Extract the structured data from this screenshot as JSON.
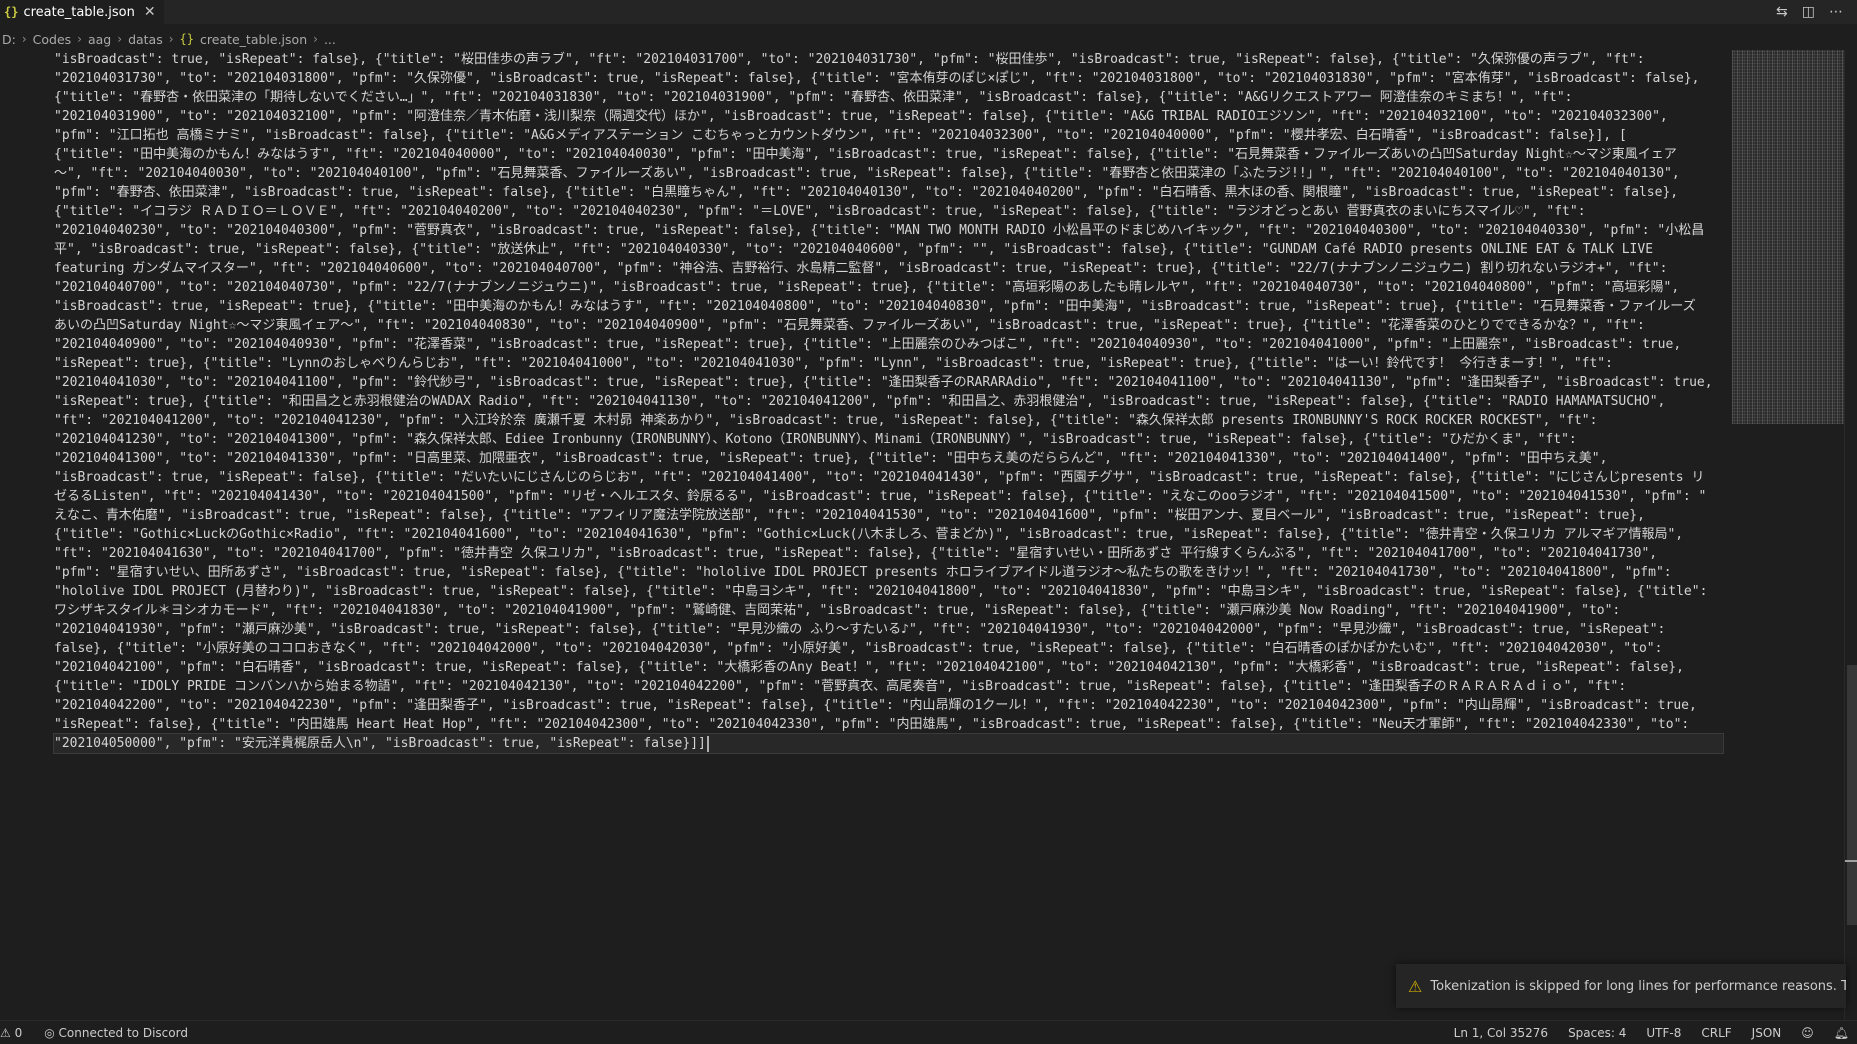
{
  "tab": {
    "label": "create_table.json",
    "icon": "{}"
  },
  "breadcrumb": {
    "items": [
      "D:",
      "Codes",
      "aag",
      "datas"
    ],
    "file_icon": "{}",
    "file": "create_table.json",
    "tail": "..."
  },
  "code_lines": [
    "\"isBroadcast\": true, \"isRepeat\": false}, {\"title\": \"桜田佳歩の声ラブ\", \"ft\": \"202104031700\", \"to\": \"202104031730\", \"pfm\": \"桜田佳歩\", \"isBroadcast\": true, \"isRepeat\": false}, {\"title\": \"久保弥優の声ラブ\", \"ft\":",
    "\"202104031730\", \"to\": \"202104031800\", \"pfm\": \"久保弥優\", \"isBroadcast\": true, \"isRepeat\": false}, {\"title\": \"宮本侑芽のぽじ×ぽじ\", \"ft\": \"202104031800\", \"to\": \"202104031830\", \"pfm\": \"宮本侑芽\", \"isBroadcast\": false},",
    "{\"title\": \"春野杏・依田菜津の「期待しないでください…」\", \"ft\": \"202104031830\", \"to\": \"202104031900\", \"pfm\": \"春野杏、依田菜津\", \"isBroadcast\": false}, {\"title\": \"A&Gリクエストアワー 阿澄佳奈のキミまち！\", \"ft\":",
    "\"202104031900\", \"to\": \"202104032100\", \"pfm\": \"阿澄佳奈／青木佑磨・浅川梨奈（隔週交代）ほか\", \"isBroadcast\": true, \"isRepeat\": false}, {\"title\": \"A&G TRIBAL RADIOエジソン\", \"ft\": \"202104032100\", \"to\": \"202104032300\",",
    "\"pfm\": \"江口拓也 高橋ミナミ\", \"isBroadcast\": false}, {\"title\": \"A&Gメディアステーション こむちゃっとカウントダウン\", \"ft\": \"202104032300\", \"to\": \"202104040000\", \"pfm\": \"櫻井孝宏、白石晴香\", \"isBroadcast\": false}], [",
    "{\"title\": \"田中美海のかもん！みなはうす\", \"ft\": \"202104040000\", \"to\": \"202104040030\", \"pfm\": \"田中美海\", \"isBroadcast\": true, \"isRepeat\": false}, {\"title\": \"石見舞菜香・ファイルーズあいの凸凹Saturday Night☆～マジ東風イェア",
    "～\", \"ft\": \"202104040030\", \"to\": \"202104040100\", \"pfm\": \"石見舞菜香、ファイルーズあい\", \"isBroadcast\": true, \"isRepeat\": false}, {\"title\": \"春野杏と依田菜津の「ふたラジ!!」\", \"ft\": \"202104040100\", \"to\": \"202104040130\",",
    "\"pfm\": \"春野杏、依田菜津\", \"isBroadcast\": true, \"isRepeat\": false}, {\"title\": \"白黒瞳ちゃん\", \"ft\": \"202104040130\", \"to\": \"202104040200\", \"pfm\": \"白石晴香、黒木ほの香、関根瞳\", \"isBroadcast\": true, \"isRepeat\": false},",
    "{\"title\": \"イコラジ ＲＡＤＩＯ＝ＬＯＶＥ\", \"ft\": \"202104040200\", \"to\": \"202104040230\", \"pfm\": \"＝LOVE\", \"isBroadcast\": true, \"isRepeat\": false}, {\"title\": \"ラジオどっとあい 菅野真衣のまいにちスマイル♡\", \"ft\":",
    "\"202104040230\", \"to\": \"202104040300\", \"pfm\": \"菅野真衣\", \"isBroadcast\": true, \"isRepeat\": false}, {\"title\": \"MAN TWO MONTH RADIO 小松昌平のドまじめハイキック\", \"ft\": \"202104040300\", \"to\": \"202104040330\", \"pfm\": \"小松昌",
    "平\", \"isBroadcast\": true, \"isRepeat\": false}, {\"title\": \"放送休止\", \"ft\": \"202104040330\", \"to\": \"202104040600\", \"pfm\": \"\", \"isBroadcast\": false}, {\"title\": \"GUNDAM Café RADIO presents ONLINE EAT & TALK LIVE",
    "featuring ガンダムマイスター\", \"ft\": \"202104040600\", \"to\": \"202104040700\", \"pfm\": \"神谷浩、吉野裕行、水島精二監督\", \"isBroadcast\": true, \"isRepeat\": true}, {\"title\": \"22/7(ナナブンノニジュウニ) 割り切れないラジオ+\", \"ft\":",
    "\"202104040700\", \"to\": \"202104040730\", \"pfm\": \"22/7(ナナブンノニジュウニ)\", \"isBroadcast\": true, \"isRepeat\": true}, {\"title\": \"高垣彩陽のあしたも晴レルヤ\", \"ft\": \"202104040730\", \"to\": \"202104040800\", \"pfm\": \"高垣彩陽\",",
    "\"isBroadcast\": true, \"isRepeat\": true}, {\"title\": \"田中美海のかもん！みなはうす\", \"ft\": \"202104040800\", \"to\": \"202104040830\", \"pfm\": \"田中美海\", \"isBroadcast\": true, \"isRepeat\": true}, {\"title\": \"石見舞菜香・ファイルーズ",
    "あいの凸凹Saturday Night☆～マジ東風イェア～\", \"ft\": \"202104040830\", \"to\": \"202104040900\", \"pfm\": \"石見舞菜香、ファイルーズあい\", \"isBroadcast\": true, \"isRepeat\": true}, {\"title\": \"花澤香菜のひとりでできるかな？\", \"ft\":",
    "\"202104040900\", \"to\": \"202104040930\", \"pfm\": \"花澤香菜\", \"isBroadcast\": true, \"isRepeat\": true}, {\"title\": \"上田麗奈のひみつばこ\", \"ft\": \"202104040930\", \"to\": \"202104041000\", \"pfm\": \"上田麗奈\", \"isBroadcast\": true,",
    "\"isRepeat\": true}, {\"title\": \"Lynnのおしゃべりんらじお\", \"ft\": \"202104041000\", \"to\": \"202104041030\", \"pfm\": \"Lynn\", \"isBroadcast\": true, \"isRepeat\": true}, {\"title\": \"はーい！鈴代です！ 今行きまーす！\", \"ft\":",
    "\"202104041030\", \"to\": \"202104041100\", \"pfm\": \"鈴代紗弓\", \"isBroadcast\": true, \"isRepeat\": true}, {\"title\": \"逢田梨香子のRARARAdio\", \"ft\": \"202104041100\", \"to\": \"202104041130\", \"pfm\": \"逢田梨香子\", \"isBroadcast\": true,",
    "\"isRepeat\": true}, {\"title\": \"和田昌之と赤羽根健治のWADAX Radio\", \"ft\": \"202104041130\", \"to\": \"202104041200\", \"pfm\": \"和田昌之、赤羽根健治\", \"isBroadcast\": true, \"isRepeat\": false}, {\"title\": \"RADIO HAMAMATSUCHO\",",
    "\"ft\": \"202104041200\", \"to\": \"202104041230\", \"pfm\": \"入江玲於奈 廣瀬千夏 木村昴 神楽あかり\", \"isBroadcast\": true, \"isRepeat\": false}, {\"title\": \"森久保祥太郎 presents IRONBUNNY'S ROCK ROCKER ROCKEST\", \"ft\":",
    "\"202104041230\", \"to\": \"202104041300\", \"pfm\": \"森久保祥太郎、Ediee Ironbunny（IRONBUNNY）、Kotono（IRONBUNNY）、Minami（IRONBUNNY）\", \"isBroadcast\": true, \"isRepeat\": false}, {\"title\": \"ひだかくま\", \"ft\":",
    "\"202104041300\", \"to\": \"202104041330\", \"pfm\": \"日高里菜、加隈亜衣\", \"isBroadcast\": true, \"isRepeat\": true}, {\"title\": \"田中ちえ美のだららんど\", \"ft\": \"202104041330\", \"to\": \"202104041400\", \"pfm\": \"田中ちえ美\",",
    "\"isBroadcast\": true, \"isRepeat\": false}, {\"title\": \"だいたいにじさんじのらじお\", \"ft\": \"202104041400\", \"to\": \"202104041430\", \"pfm\": \"西園チグサ\", \"isBroadcast\": true, \"isRepeat\": false}, {\"title\": \"にじさんじpresents リ",
    "ゼるるListen\", \"ft\": \"202104041430\", \"to\": \"202104041500\", \"pfm\": \"リゼ・ヘルエスタ、鈴原るる\", \"isBroadcast\": true, \"isRepeat\": false}, {\"title\": \"えなこのooラジオ\", \"ft\": \"202104041500\", \"to\": \"202104041530\", \"pfm\": \"",
    "えなこ、青木佑磨\", \"isBroadcast\": true, \"isRepeat\": false}, {\"title\": \"アフィリア魔法学院放送部\", \"ft\": \"202104041530\", \"to\": \"202104041600\", \"pfm\": \"桜田アンナ、夏目ベール\", \"isBroadcast\": true, \"isRepeat\": true},",
    "{\"title\": \"Gothic×LuckのGothic×Radio\", \"ft\": \"202104041600\", \"to\": \"202104041630\", \"pfm\": \"Gothic×Luck(八木ましろ、菅まどか)\", \"isBroadcast\": true, \"isRepeat\": false}, {\"title\": \"徳井青空・久保ユリカ アルマギア情報局\",",
    "\"ft\": \"202104041630\", \"to\": \"202104041700\", \"pfm\": \"徳井青空 久保ユリカ\", \"isBroadcast\": true, \"isRepeat\": false}, {\"title\": \"星宿すいせい・田所あずさ 平行線すくらんぶる\", \"ft\": \"202104041700\", \"to\": \"202104041730\",",
    "\"pfm\": \"星宿すいせい、田所あずさ\", \"isBroadcast\": true, \"isRepeat\": false}, {\"title\": \"hololive IDOL PROJECT presents ホロライブアイドル道ラジオ～私たちの歌をきけッ！\", \"ft\": \"202104041730\", \"to\": \"202104041800\", \"pfm\":",
    "\"hololive IDOL PROJECT (月替わり)\", \"isBroadcast\": true, \"isRepeat\": false}, {\"title\": \"中島ヨシキ\", \"ft\": \"202104041800\", \"to\": \"202104041830\", \"pfm\": \"中島ヨシキ\", \"isBroadcast\": true, \"isRepeat\": false}, {\"title\": \"",
    "ワシザキスタイル＊ヨシオカモード\", \"ft\": \"202104041830\", \"to\": \"202104041900\", \"pfm\": \"鷲崎健、吉岡茉祐\", \"isBroadcast\": true, \"isRepeat\": false}, {\"title\": \"瀬戸麻沙美 Now Roading\", \"ft\": \"202104041900\", \"to\":",
    "\"202104041930\", \"pfm\": \"瀬戸麻沙美\", \"isBroadcast\": true, \"isRepeat\": false}, {\"title\": \"早見沙織の ふり～すたいる♪\", \"ft\": \"202104041930\", \"to\": \"202104042000\", \"pfm\": \"早見沙織\", \"isBroadcast\": true, \"isRepeat\":",
    "false}, {\"title\": \"小原好美のココロおきなく\", \"ft\": \"202104042000\", \"to\": \"202104042030\", \"pfm\": \"小原好美\", \"isBroadcast\": true, \"isRepeat\": false}, {\"title\": \"白石晴香のぽかぽかたいむ\", \"ft\": \"202104042030\", \"to\":",
    "\"202104042100\", \"pfm\": \"白石晴香\", \"isBroadcast\": true, \"isRepeat\": false}, {\"title\": \"大橋彩香のAny Beat！\", \"ft\": \"202104042100\", \"to\": \"202104042130\", \"pfm\": \"大橋彩香\", \"isBroadcast\": true, \"isRepeat\": false},",
    "{\"title\": \"IDOLY PRIDE コンバンハから始まる物語\", \"ft\": \"202104042130\", \"to\": \"202104042200\", \"pfm\": \"菅野真衣、高尾奏音\", \"isBroadcast\": true, \"isRepeat\": false}, {\"title\": \"逢田梨香子のＲＡＲＡＲＡｄｉｏ\", \"ft\":",
    "\"202104042200\", \"to\": \"202104042230\", \"pfm\": \"逢田梨香子\", \"isBroadcast\": true, \"isRepeat\": false}, {\"title\": \"内山昂輝の1クール！\", \"ft\": \"202104042230\", \"to\": \"202104042300\", \"pfm\": \"内山昂輝\", \"isBroadcast\": true,",
    "\"isRepeat\": false}, {\"title\": \"内田雄馬 Heart Heat Hop\", \"ft\": \"202104042300\", \"to\": \"202104042330\", \"pfm\": \"内田雄馬\", \"isBroadcast\": true, \"isRepeat\": false}, {\"title\": \"Neu天才軍師\", \"ft\": \"202104042330\", \"to\":",
    "\"202104050000\", \"pfm\": \"安元洋貴梶原岳人\\n\", \"isBroadcast\": true, \"isRepeat\": false}]]"
  ],
  "notification": {
    "text": "Tokenization is skipped for long lines for performance reasons. The len..."
  },
  "status": {
    "problems": "⚠ 0",
    "discord": "Connected to Discord",
    "position": "Ln 1, Col 35276",
    "spaces": "Spaces: 4",
    "encoding": "UTF-8",
    "eol": "CRLF",
    "language": "JSON"
  },
  "colors": {
    "background": "#1e1e1e",
    "text": "#d4d4d4",
    "json_icon": "#cbcb41",
    "warning": "#cca700"
  }
}
